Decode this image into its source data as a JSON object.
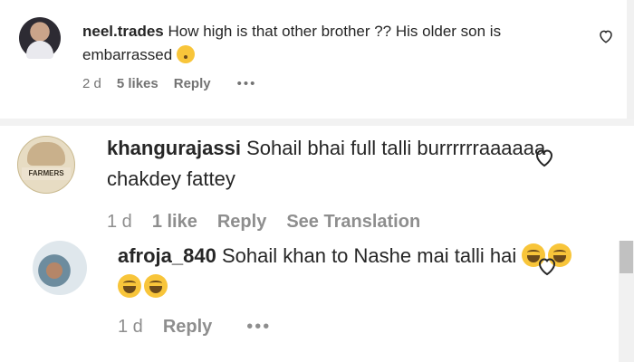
{
  "comments": [
    {
      "username": "neel.trades",
      "text": "How high is that other brother ?? His older son is embarrassed",
      "time": "2 d",
      "likes": "5 likes",
      "reply": "Reply",
      "more": "•••"
    },
    {
      "username": "khangurajassi",
      "text": "Sohail bhai full talli burrrrrraaaaaa chakdey fattey",
      "time": "1 d",
      "likes": "1 like",
      "reply": "Reply",
      "translate": "See Translation",
      "avatar_text": "FARMERS"
    },
    {
      "username": "afroja_840",
      "text": "Sohail khan to Nashe mai talli hai",
      "time": "1 d",
      "reply": "Reply",
      "more": "•••"
    }
  ],
  "icons": {
    "like": "heart-outline-icon",
    "emoji_embarrassed": "flushed-face-emoji",
    "emoji_laugh": "tears-of-joy-emoji"
  },
  "colors": {
    "text": "#262626",
    "meta": "#8e8e8e"
  }
}
